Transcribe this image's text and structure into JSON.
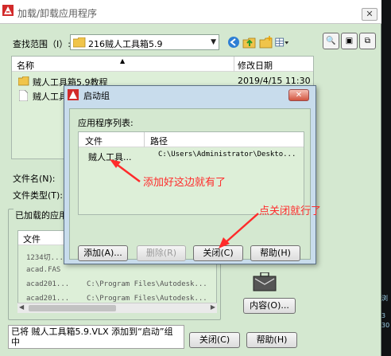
{
  "main": {
    "title": "加载/卸载应用程序",
    "close_symbol": "✕",
    "search_label": "查找范围（I）:",
    "search_value": "216贼人工具箱5.9",
    "file_list": {
      "columns": [
        "名称",
        "修改日期"
      ],
      "rows": [
        {
          "name": "贼人工具箱5.9教程",
          "date": "2019/4/15 11:30"
        },
        {
          "name": "贼人工具箱5.9.VLX",
          "date": ""
        }
      ]
    },
    "file_name_label": "文件名(N):",
    "file_type_label": "文件类型(T):",
    "loaded_group": {
      "caption": "已加载的应用程序",
      "column": "文件",
      "rows": [
        {
          "file": "1234切...",
          "path": ""
        },
        {
          "file": "acad.FAS",
          "path": ""
        },
        {
          "file": "acad201...",
          "path": "C:\\Program Files\\Autodesk..."
        },
        {
          "file": "acad201...",
          "path": "C:\\Program Files\\Autodesk..."
        }
      ]
    },
    "contents_button": "内容(O)...",
    "status_text": "已将 贼人工具箱5.9.VLX 添加到“启动”组中",
    "close_button": "关闭(C)",
    "help_button": "帮助(H)"
  },
  "startup": {
    "title": "启动组",
    "close_symbol": "✕",
    "list_label": "应用程序列表:",
    "columns": [
      "文件",
      "路径"
    ],
    "rows": [
      {
        "file": "贼人工具...",
        "path": "C:\\Users\\Administrator\\Deskto..."
      }
    ],
    "buttons": {
      "add": "添加(A)...",
      "remove": "删除(R)",
      "close": "关闭(C)",
      "help": "帮助(H)"
    }
  },
  "annotations": {
    "added_note": "添加好这边就有了",
    "close_note": "点关闭就行了"
  },
  "background": {
    "strip_text": [
      "浏",
      "3",
      "30"
    ]
  },
  "colors": {
    "annotation": "#ff2b2b",
    "dialog_bg": "#d4e8d0",
    "startup_frame": "#c8dcec",
    "close_red": "#d2543e"
  },
  "icons": [
    "autocad-icon",
    "folder-icon",
    "file-icon",
    "back-icon",
    "up-folder-icon",
    "new-folder-icon",
    "views-icon",
    "preview-icon",
    "briefcase-icon"
  ]
}
